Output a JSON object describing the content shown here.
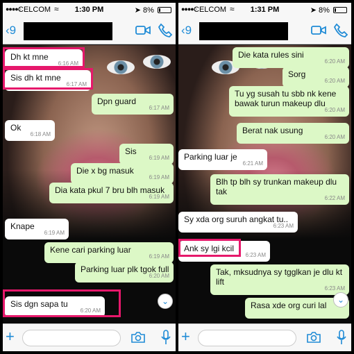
{
  "colors": {
    "accent": "#1f8bd6",
    "incoming_bubble": "#ffffff",
    "outgoing_bubble": "#dcf8c6",
    "highlight": "#e6186b"
  },
  "panels": [
    {
      "status": {
        "carrier": "CELCOM",
        "time": "1:30 PM",
        "battery": "8%"
      },
      "nav": {
        "back": "9"
      },
      "messages": [
        {
          "dir": "in",
          "text": "Dh kt mne",
          "time": "6:16 AM",
          "highlighted": true
        },
        {
          "dir": "in",
          "text": "Sis dh kt mne",
          "time": "6:17 AM",
          "highlighted": true
        },
        {
          "dir": "out",
          "text": "Dpn guard",
          "time": "6:17 AM"
        },
        {
          "dir": "in",
          "text": "Ok",
          "time": "6:18 AM"
        },
        {
          "dir": "out",
          "text": "Sis",
          "time": "6:19 AM"
        },
        {
          "dir": "out",
          "text": "Die x bg masuk",
          "time": "6:19 AM"
        },
        {
          "dir": "out",
          "text": "Dia kata pkul 7 bru blh masuk",
          "time": "6:19 AM"
        },
        {
          "dir": "in",
          "text": "Knape",
          "time": "6:19 AM"
        },
        {
          "dir": "out",
          "text": "Kene cari parking luar",
          "time": "6:19 AM"
        },
        {
          "dir": "out",
          "text": "Parking luar plk tgok full",
          "time": "6:20 AM"
        },
        {
          "dir": "in",
          "text": "Sis dgn sapa tu",
          "time": "6:20 AM",
          "highlighted": true
        }
      ]
    },
    {
      "status": {
        "carrier": "CELCOM",
        "time": "1:31 PM",
        "battery": "8%"
      },
      "nav": {
        "back": "9"
      },
      "messages": [
        {
          "dir": "out",
          "text": "Die kata rules sini",
          "time": "6:20 AM"
        },
        {
          "dir": "out",
          "text": "Sorg",
          "time": "6:20 AM"
        },
        {
          "dir": "out",
          "text": "Tu yg susah tu sbb nk kene bawak turun makeup dlu",
          "time": "6:20 AM"
        },
        {
          "dir": "out",
          "text": "Berat nak usung",
          "time": "6:20 AM"
        },
        {
          "dir": "in",
          "text": "Parking luar je",
          "time": "6:21 AM"
        },
        {
          "dir": "out",
          "text": "Blh tp blh sy trunkan makeup dlu tak",
          "time": "6:22 AM"
        },
        {
          "dir": "in",
          "text": "Sy xda org suruh angkat tu..",
          "time": "6:23 AM"
        },
        {
          "dir": "in",
          "text": "Ank sy lgi kcil",
          "time": "6:23 AM",
          "highlighted": true
        },
        {
          "dir": "out",
          "text": "Tak, mksudnya sy tgglkan je dlu kt lift",
          "time": "6:23 AM"
        },
        {
          "dir": "out",
          "text": "Rasa xde org curi lal",
          "time": ""
        }
      ]
    }
  ]
}
